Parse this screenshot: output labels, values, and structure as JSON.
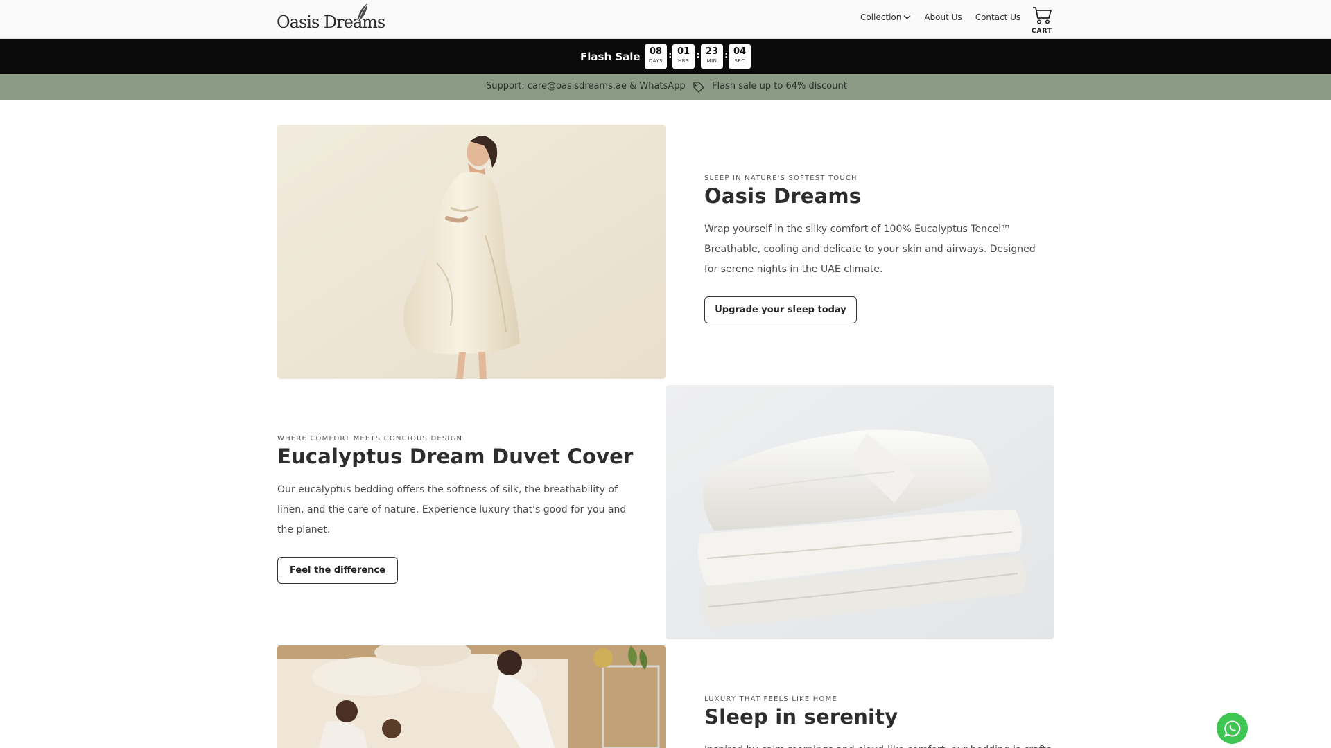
{
  "header": {
    "logo_text": "Oasis Dreams",
    "nav": [
      {
        "label": "Collection"
      },
      {
        "label": "About Us"
      },
      {
        "label": "Contact Us"
      }
    ],
    "cart_label": "CART"
  },
  "flash_sale": {
    "label": "Flash Sale",
    "countdown": {
      "days": "08",
      "days_unit": "DAYS",
      "hrs": "01",
      "hrs_unit": "HRS",
      "min": "23",
      "min_unit": "MIN",
      "sec": "04",
      "sec_unit": "SEC",
      "separator": ":"
    }
  },
  "support_bar": {
    "support_text": "Support: care@oasisdreams.ae & WhatsApp",
    "sale_text": "Flash sale up to 64% discount",
    "background": "#8a9a85"
  },
  "sections": [
    {
      "eyebrow": "SLEEP IN NATURE'S SOFTEST TOUCH",
      "title": "Oasis Dreams",
      "body": "Wrap yourself in the silky comfort of 100% Eucalyptus Tencel™ Breathable, cooling and delicate to your skin and airways. Designed for serene nights in the UAE climate.",
      "cta": "Upgrade your sleep today"
    },
    {
      "eyebrow": "WHERE COMFORT MEETS CONCIOUS DESIGN",
      "title": "Eucalyptus Dream Duvet Cover",
      "body": "Our eucalyptus bedding offers the softness of silk, the breathability of linen, and the care of nature. Experience luxury that's good for you and the planet.",
      "cta": "Feel the difference"
    },
    {
      "eyebrow": "LUXURY THAT FEELS LIKE HOME",
      "title": "Sleep in serenity",
      "body": "Inspired by calm mornings and cloud-like comfort, our bedding is crafted for you"
    }
  ],
  "colors": {
    "flash_bg": "#0b0b0b",
    "whatsapp_green": "#3fc552"
  }
}
